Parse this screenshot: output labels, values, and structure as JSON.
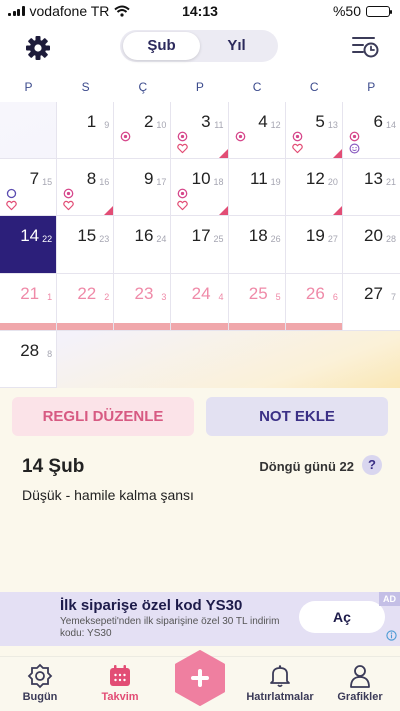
{
  "status_bar": {
    "carrier": "vodafone TR",
    "time": "14:13",
    "battery": "%50",
    "battery_level": 0.5
  },
  "header": {
    "segment": {
      "month": "Şub",
      "year": "Yıl"
    }
  },
  "weekdays": [
    "P",
    "S",
    "Ç",
    "P",
    "C",
    "C",
    "P"
  ],
  "calendar": {
    "days": [
      {
        "day": "1",
        "cycle": "9",
        "markers": []
      },
      {
        "day": "2",
        "cycle": "10",
        "markers": [
          "target"
        ]
      },
      {
        "day": "3",
        "cycle": "11",
        "markers": [
          "target",
          "heart"
        ],
        "corner": true
      },
      {
        "day": "4",
        "cycle": "12",
        "markers": [
          "target"
        ]
      },
      {
        "day": "5",
        "cycle": "13",
        "markers": [
          "target",
          "heart"
        ],
        "corner": true
      },
      {
        "day": "6",
        "cycle": "14",
        "markers": [
          "target",
          "smile"
        ]
      },
      {
        "day": "7",
        "cycle": "15",
        "markers": [
          "circle",
          "heart"
        ]
      },
      {
        "day": "8",
        "cycle": "16",
        "markers": [
          "target",
          "heart"
        ],
        "corner": true
      },
      {
        "day": "9",
        "cycle": "17",
        "markers": []
      },
      {
        "day": "10",
        "cycle": "18",
        "markers": [
          "target",
          "heart"
        ],
        "corner": true
      },
      {
        "day": "11",
        "cycle": "19",
        "markers": []
      },
      {
        "day": "12",
        "cycle": "20",
        "markers": [],
        "corner": true
      },
      {
        "day": "13",
        "cycle": "21",
        "markers": []
      },
      {
        "day": "14",
        "cycle": "22",
        "markers": [],
        "today": true
      },
      {
        "day": "15",
        "cycle": "23",
        "markers": []
      },
      {
        "day": "16",
        "cycle": "24",
        "markers": []
      },
      {
        "day": "17",
        "cycle": "25",
        "markers": []
      },
      {
        "day": "18",
        "cycle": "26",
        "markers": []
      },
      {
        "day": "19",
        "cycle": "27",
        "markers": []
      },
      {
        "day": "20",
        "cycle": "28",
        "markers": []
      },
      {
        "day": "21",
        "cycle": "1",
        "markers": [],
        "period": true
      },
      {
        "day": "22",
        "cycle": "2",
        "markers": [],
        "period": true
      },
      {
        "day": "23",
        "cycle": "3",
        "markers": [],
        "period": true
      },
      {
        "day": "24",
        "cycle": "4",
        "markers": [],
        "period": true
      },
      {
        "day": "25",
        "cycle": "5",
        "markers": [],
        "period": true
      },
      {
        "day": "26",
        "cycle": "6",
        "markers": [],
        "period": true
      },
      {
        "day": "27",
        "cycle": "7",
        "markers": []
      },
      {
        "day": "28",
        "cycle": "8",
        "markers": []
      }
    ]
  },
  "actions": {
    "edit_period": "REGLI DÜZENLE",
    "add_note": "NOT EKLE"
  },
  "selected_day": {
    "date": "14 Şub",
    "cycle_day": "Döngü günü 22",
    "help": "?",
    "pregnancy_chance": "Düşük - hamile kalma şansı"
  },
  "ad": {
    "tag": "AD",
    "title": "İlk siparişe özel kod YS30",
    "body": "Yemeksepeti'nden ilk siparişine özel 30 TL indirim kodu: YS30",
    "cta": "Aç"
  },
  "tabbar": {
    "today": "Bugün",
    "calendar": "Takvim",
    "reminders": "Hatırlatmalar",
    "charts": "Grafikler",
    "active": "calendar"
  },
  "colors": {
    "accent": "#e24d75",
    "today_bg": "#2c1f7a",
    "period_bar": "#f0a7ab",
    "period_text": "#ef8aa8",
    "brand": "#3b3086"
  }
}
